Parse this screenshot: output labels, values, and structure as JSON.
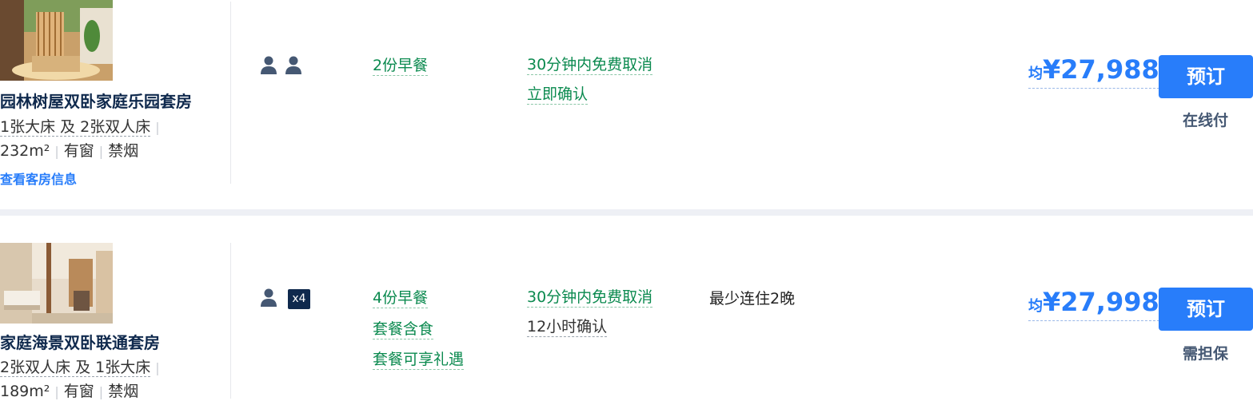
{
  "rooms": [
    {
      "name": "园林树屋双卧家庭乐园套房",
      "beds": "1张大床 及 2张双人床",
      "area": "232m²",
      "window": "有窗",
      "smoking": "禁烟",
      "view_link": "查看客房信息",
      "meals": "2份早餐",
      "cancel": "30分钟内免费取消",
      "confirm": "立即确认",
      "price_prefix": "均",
      "price": "¥27,988",
      "book_label": "预订",
      "pay_type": "在线付"
    },
    {
      "name": "家庭海景双卧联通套房",
      "beds": "2张双人床 及 1张大床",
      "area": "189m²",
      "window": "有窗",
      "smoking": "禁烟",
      "guest_badge": "x4",
      "meals": "4份早餐",
      "package_meal": "套餐含食",
      "package_gift": "套餐可享礼遇",
      "cancel": "30分钟内免费取消",
      "confirm": "12小时确认",
      "min_stay": "最少连住2晚",
      "price_prefix": "均",
      "price": "¥27,998",
      "book_label": "预订",
      "pay_type": "需担保"
    }
  ],
  "colors": {
    "accent": "#287dfa",
    "green": "#0b8a4f",
    "title": "#0f294d"
  },
  "icons": {
    "guest": "person-icon"
  }
}
